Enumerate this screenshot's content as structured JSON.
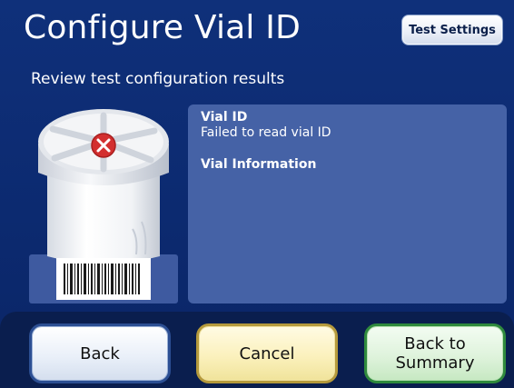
{
  "header": {
    "title": "Configure Vial ID",
    "test_settings_label": "Test Settings"
  },
  "subtitle": "Review test configuration results",
  "vial_image": {
    "status_icon": "error-x-icon",
    "status_color": "#d32f2f"
  },
  "info_panel": {
    "vial_id_label": "Vial ID",
    "vial_id_value": "Failed to read vial ID",
    "vial_info_label": "Vial Information"
  },
  "footer": {
    "back_label": "Back",
    "cancel_label": "Cancel",
    "summary_label_line1": "Back to",
    "summary_label_line2": "Summary"
  },
  "colors": {
    "background": "#0f307a",
    "panel": "#4562a6",
    "back_border": "#2c4f93",
    "cancel_border": "#b59a3c",
    "summary_border": "#2f8a3d"
  }
}
